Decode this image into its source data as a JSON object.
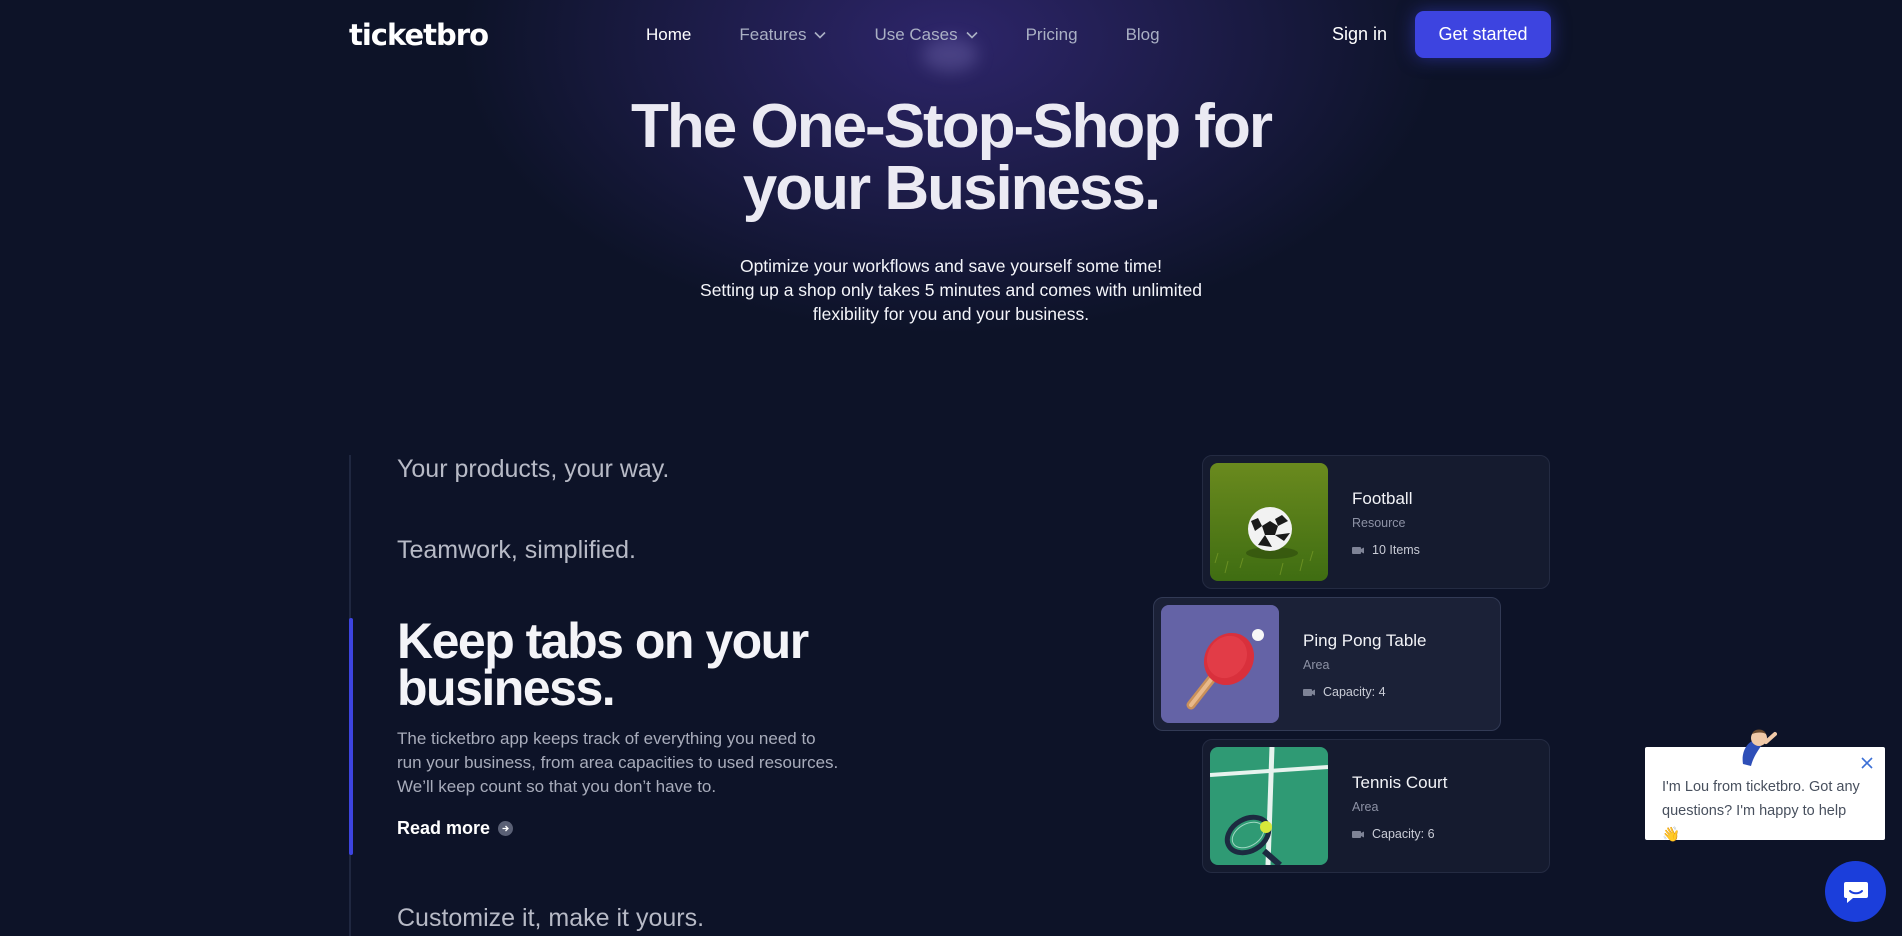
{
  "nav": {
    "logo": "ticketbro",
    "links": [
      {
        "label": "Home",
        "dropdown": false
      },
      {
        "label": "Features",
        "dropdown": true
      },
      {
        "label": "Use Cases",
        "dropdown": true
      },
      {
        "label": "Pricing",
        "dropdown": false
      },
      {
        "label": "Blog",
        "dropdown": false
      }
    ],
    "sign_in": "Sign in",
    "cta": "Get started"
  },
  "hero": {
    "title_line1": "The One-Stop-Shop for",
    "title_line2": "your Business.",
    "sub_line1": "Optimize your workflows and save yourself some time!",
    "sub_line2": "Setting up a shop only takes 5 minutes and comes with unlimited",
    "sub_line3": "flexibility for you and your business."
  },
  "features": {
    "items": [
      "Your products, your way.",
      "Teamwork, simplified.",
      "Customize it, make it yours."
    ],
    "active": {
      "title_line1": "Keep tabs on your",
      "title_line2": "business.",
      "desc_line1": "The ticketbro app keeps track of everything you need to",
      "desc_line2": "run your business, from area capacities to used resources.",
      "desc_line3": "We’ll keep count so that you don’t have to.",
      "read_more": "Read more"
    }
  },
  "cards": [
    {
      "title": "Football",
      "type": "Resource",
      "meta": "10 Items",
      "icon": "football-image"
    },
    {
      "title": "Ping Pong Table",
      "type": "Area",
      "meta": "Capacity: 4",
      "icon": "ping-pong-image"
    },
    {
      "title": "Tennis Court",
      "type": "Area",
      "meta": "Capacity: 6",
      "icon": "tennis-court-image"
    }
  ],
  "chat": {
    "message": "I'm Lou from ticketbro. Got any questions? I'm happy to help 👋"
  },
  "colors": {
    "background": "#0d1328",
    "accent": "#3d44e0",
    "chat_launcher": "#1b3edb"
  }
}
